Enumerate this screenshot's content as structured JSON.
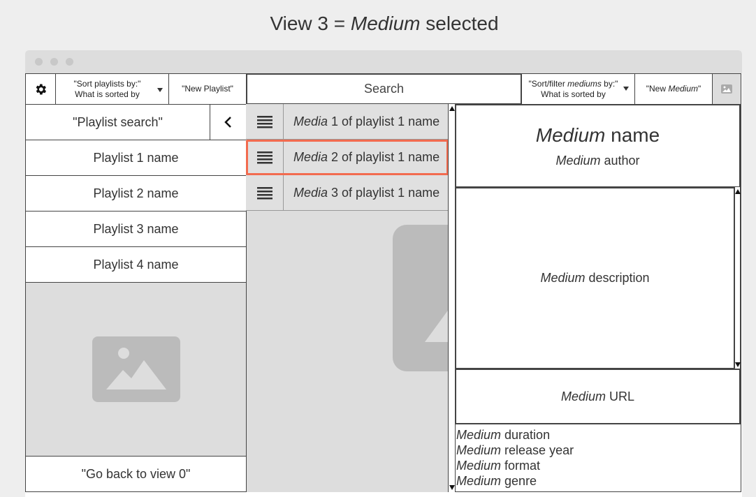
{
  "page": {
    "title_prefix": "View 3 = ",
    "title_em": "Medium",
    "title_suffix": " selected"
  },
  "toolbar": {
    "settings_icon": "gear-icon",
    "sort_playlists_line1": "\"Sort playlists by:\"",
    "sort_playlists_line2": "What is sorted by",
    "new_playlist": "\"New Playlist\"",
    "search": "Search",
    "sort_mediums_pre": "\"Sort/filter ",
    "sort_mediums_em": "mediums",
    "sort_mediums_post": " by:\"",
    "sort_mediums_line2": "What is sorted by",
    "new_medium_pre": "\"New ",
    "new_medium_em": "Medium",
    "new_medium_post": "\"",
    "image_icon": "image-icon"
  },
  "sidebar": {
    "playlist_search": "\"Playlist search\"",
    "back_icon": "chevron-left-icon",
    "playlists": [
      {
        "label": "Playlist 1 name"
      },
      {
        "label": "Playlist 2 name"
      },
      {
        "label": "Playlist 3 name"
      },
      {
        "label": "Playlist 4 name"
      }
    ],
    "go_back": "\"Go back to view 0\""
  },
  "media_list": {
    "items": [
      {
        "em": "Media",
        "rest": " 1 of playlist 1 name",
        "selected": false
      },
      {
        "em": "Media",
        "rest": " 2 of playlist 1 name",
        "selected": true
      },
      {
        "em": "Media",
        "rest": " 3 of playlist 1 name",
        "selected": false
      }
    ],
    "selected_color": "#f26b4f"
  },
  "detail": {
    "name_em": "Medium",
    "name_rest": " name",
    "author_em": "Medium",
    "author_rest": " author",
    "description_em": "Medium",
    "description_rest": " description",
    "url_em": "Medium",
    "url_rest": " URL",
    "meta": [
      {
        "em": "Medium",
        "rest": " duration"
      },
      {
        "em": "Medium",
        "rest": " release year"
      },
      {
        "em": "Medium",
        "rest": " format"
      },
      {
        "em": "Medium",
        "rest": " genre"
      }
    ]
  }
}
